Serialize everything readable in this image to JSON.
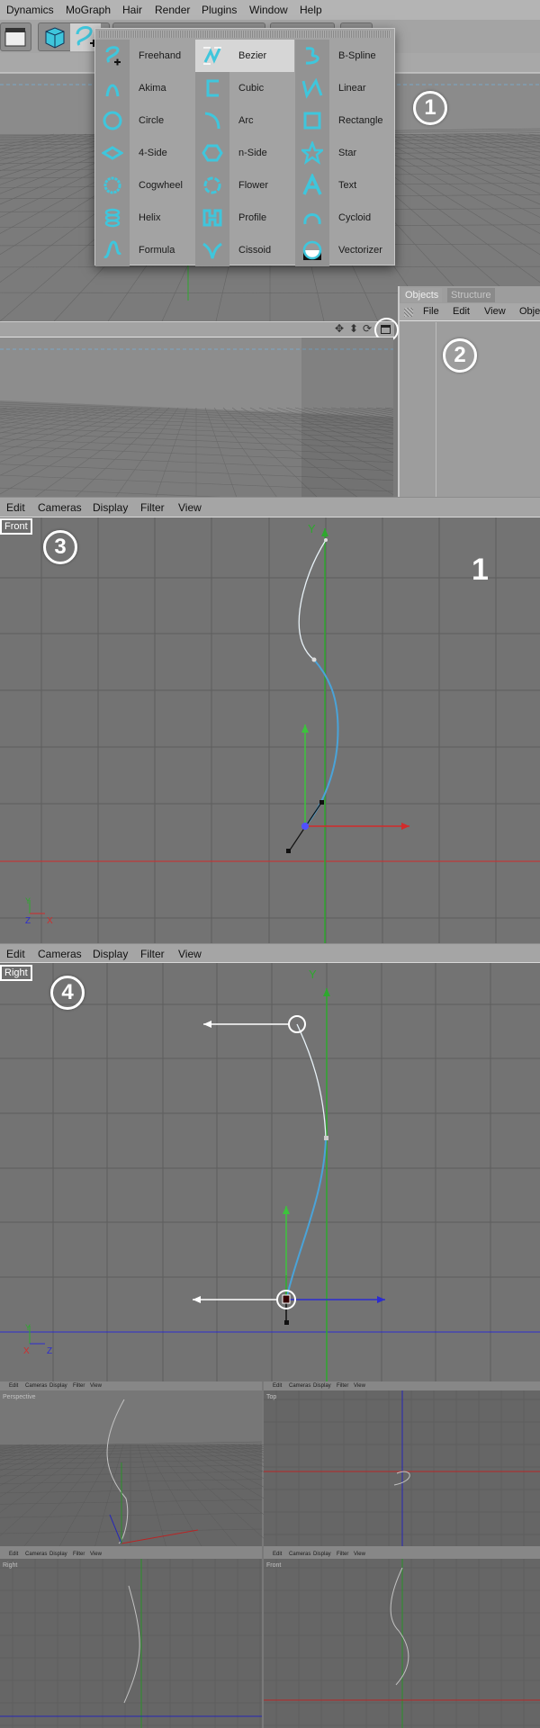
{
  "main_menu": [
    "Dynamics",
    "MoGraph",
    "Hair",
    "Render",
    "Plugins",
    "Window",
    "Help"
  ],
  "spline_menu": {
    "selected": "Bezier",
    "columns": [
      [
        {
          "label": "Freehand",
          "icon": "freehand-icon"
        },
        {
          "label": "Akima",
          "icon": "akima-icon"
        },
        {
          "label": "Circle",
          "icon": "circle-icon"
        },
        {
          "label": "4-Side",
          "icon": "4-side-icon"
        },
        {
          "label": "Cogwheel",
          "icon": "cogwheel-icon"
        },
        {
          "label": "Helix",
          "icon": "helix-icon"
        },
        {
          "label": "Formula",
          "icon": "formula-icon"
        }
      ],
      [
        {
          "label": "Bezier",
          "icon": "bezier-icon"
        },
        {
          "label": "Cubic",
          "icon": "cubic-icon"
        },
        {
          "label": "Arc",
          "icon": "arc-icon"
        },
        {
          "label": "n-Side",
          "icon": "n-side-icon"
        },
        {
          "label": "Flower",
          "icon": "flower-icon"
        },
        {
          "label": "Profile",
          "icon": "profile-icon"
        },
        {
          "label": "Cissoid",
          "icon": "cissoid-icon"
        }
      ],
      [
        {
          "label": "B-Spline",
          "icon": "b-spline-icon"
        },
        {
          "label": "Linear",
          "icon": "linear-icon"
        },
        {
          "label": "Rectangle",
          "icon": "rectangle-icon"
        },
        {
          "label": "Star",
          "icon": "star-icon"
        },
        {
          "label": "Text",
          "icon": "text-icon"
        },
        {
          "label": "Cycloid",
          "icon": "cycloid-icon"
        },
        {
          "label": "Vectorizer",
          "icon": "vectorizer-icon"
        }
      ]
    ]
  },
  "annotations": {
    "step1": "1",
    "step2": "2",
    "step3": "3",
    "step4": "4",
    "big_label": "1"
  },
  "objects_panel": {
    "tabs": [
      "Objects",
      "Structure"
    ],
    "menu": [
      "File",
      "Edit",
      "View",
      "Obje"
    ]
  },
  "viewport_menu": [
    "Edit",
    "Cameras",
    "Display",
    "Filter",
    "View"
  ],
  "viewports": {
    "front": {
      "label": "Front",
      "axis_y": "Y",
      "mini_axes": [
        "Y",
        "Z",
        "X"
      ]
    },
    "right": {
      "label": "Right",
      "axis_y": "Y",
      "mini_axes": [
        "Y",
        "X",
        "Z"
      ]
    },
    "quad": {
      "labels": [
        "Perspective",
        "Top",
        "Right",
        "Front"
      ]
    }
  },
  "colors": {
    "accent": "#3fc6dc",
    "axis_x": "#d22b2b",
    "axis_y": "#2ea82e",
    "axis_z": "#2c2ccf",
    "spline_active": "#4aa3d8"
  }
}
